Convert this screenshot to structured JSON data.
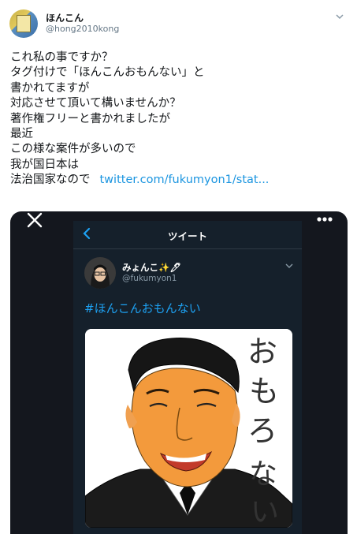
{
  "header": {
    "display_name": "ほんこん",
    "handle": "@hong2010kong"
  },
  "tweet": {
    "lines": [
      "これ私の事ですか？",
      "タグ付けで「ほんこんおもんない」と",
      "書かれてますが",
      "対応させて頂いて構いませんか？",
      "著作権フリーと書かれましたが",
      "最近",
      "この様な案件が多いので",
      "我が国日本は"
    ],
    "last_line": "法治国家なので",
    "link": "twitter.com/fukumyon1/stat..."
  },
  "embedded": {
    "title": "ツイート",
    "display_name": "みょんこ✨🖊",
    "handle": "@fukumyon1",
    "hashtag": "#ほんこんおもんない",
    "drawing_text": "おもろない"
  },
  "colors": {
    "link": "#1b95e0",
    "hashtag": "#1da1f2",
    "dark_bg": "#15202b"
  }
}
